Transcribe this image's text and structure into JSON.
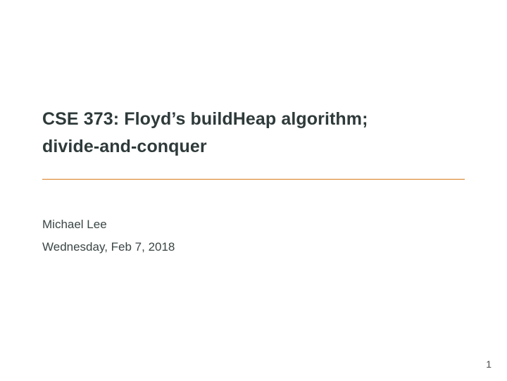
{
  "slide": {
    "title_line1": "CSE 373: Floyd’s buildHeap algorithm;",
    "title_line2": "divide-and-conquer",
    "author": "Michael Lee",
    "date": "Wednesday, Feb 7, 2018",
    "page_number": "1"
  },
  "colors": {
    "rule": "#d87a1a",
    "text": "#2f3a3a"
  }
}
